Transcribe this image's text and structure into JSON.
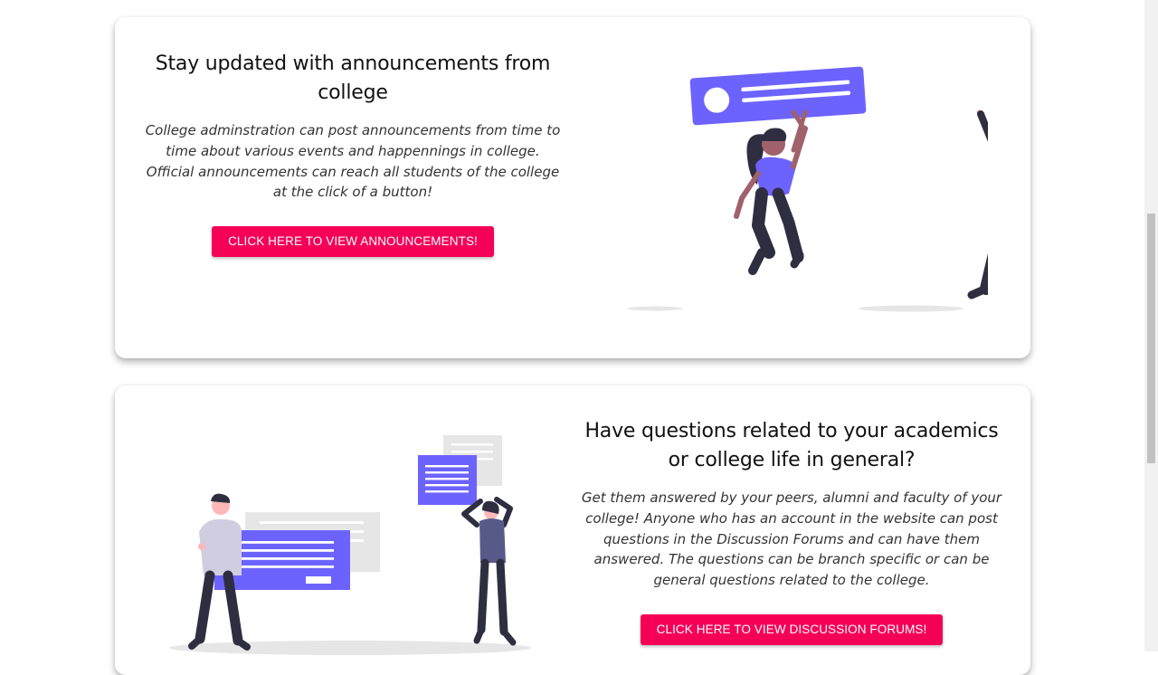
{
  "announcements": {
    "title": "Stay updated with announcements from college",
    "description": "College adminstration can post announcements from time to time about various events and happennings in college. Official announcements can reach all students of the college at the click of a button!",
    "button_label": "CLICK HERE TO VIEW ANNOUNCEMENTS!"
  },
  "forums": {
    "title": "Have questions related to your academics or college life in general?",
    "description": "Get them answered by your peers, alumni and faculty of your college! Anyone who has an account in the website can post questions in the Discussion Forums and can have them answered. The questions can be branch specific or can be general questions related to the college.",
    "button_label": "CLICK HERE TO VIEW DISCUSSION FORUMS!"
  },
  "colors": {
    "accent": "#f50057",
    "illustration_primary": "#6c63ff",
    "figure_dark": "#2f2e41",
    "skin": "#ffb8b8",
    "skin_dark": "#a0616a"
  },
  "icons": [
    "announcement-illustration",
    "discussion-forum-illustration"
  ]
}
